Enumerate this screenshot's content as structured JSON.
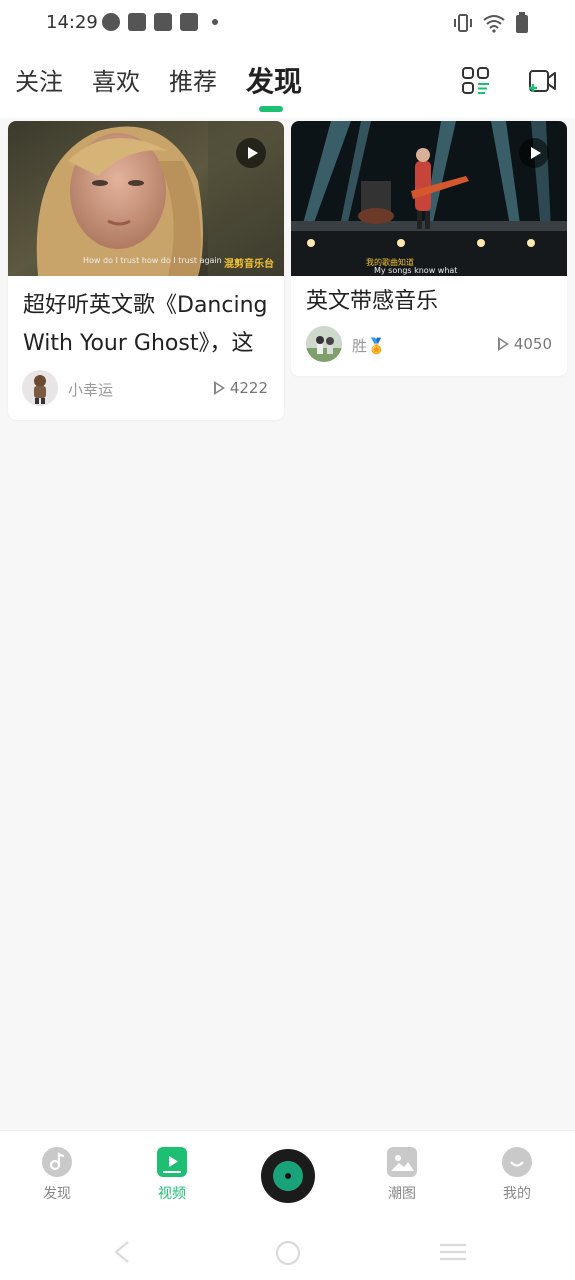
{
  "status_bar": {
    "time": "14:29",
    "icons_left": [
      "speedometer-icon",
      "shopping-bag-icon",
      "shopping-bag-icon",
      "shopping-bag-icon",
      "dot-icon"
    ],
    "icons_right": [
      "vibrate-icon",
      "wifi-icon",
      "battery-icon"
    ]
  },
  "header": {
    "tabs": [
      {
        "label": "关注",
        "active": false
      },
      {
        "label": "喜欢",
        "active": false
      },
      {
        "label": "推荐",
        "active": false
      },
      {
        "label": "发现",
        "active": true
      }
    ],
    "accent_color": "#1dbf73",
    "right_icons": [
      "category-grid-icon",
      "video-upload-icon"
    ]
  },
  "feed": {
    "cards": [
      {
        "title": "超好听英文歌《Dancing With Your Ghost》，这",
        "title_line1": "超好听英文歌《Dancing",
        "title_line2": "With Your Ghost》，这",
        "thumbnail_subtitle": "How do I trust how do I trust again",
        "thumbnail_watermark": "混剪音乐台",
        "author": "小幸运",
        "play_count": "4222"
      },
      {
        "title": "英文带感音乐",
        "thumbnail_subtitle_1": "我的歌曲知道",
        "thumbnail_subtitle_2": "My songs know what",
        "author": "胜🏅",
        "play_count": "4050"
      }
    ]
  },
  "bottom_nav": {
    "items": [
      {
        "label": "发现",
        "icon": "music-note-icon",
        "active": false
      },
      {
        "label": "视频",
        "icon": "video-play-icon",
        "active": true
      },
      {
        "label": "",
        "icon": "vinyl-disc-icon",
        "active": false
      },
      {
        "label": "潮图",
        "icon": "image-icon",
        "active": false
      },
      {
        "label": "我的",
        "icon": "profile-face-icon",
        "active": false
      }
    ]
  },
  "system_nav": [
    "back-icon",
    "home-icon",
    "menu-icon"
  ]
}
